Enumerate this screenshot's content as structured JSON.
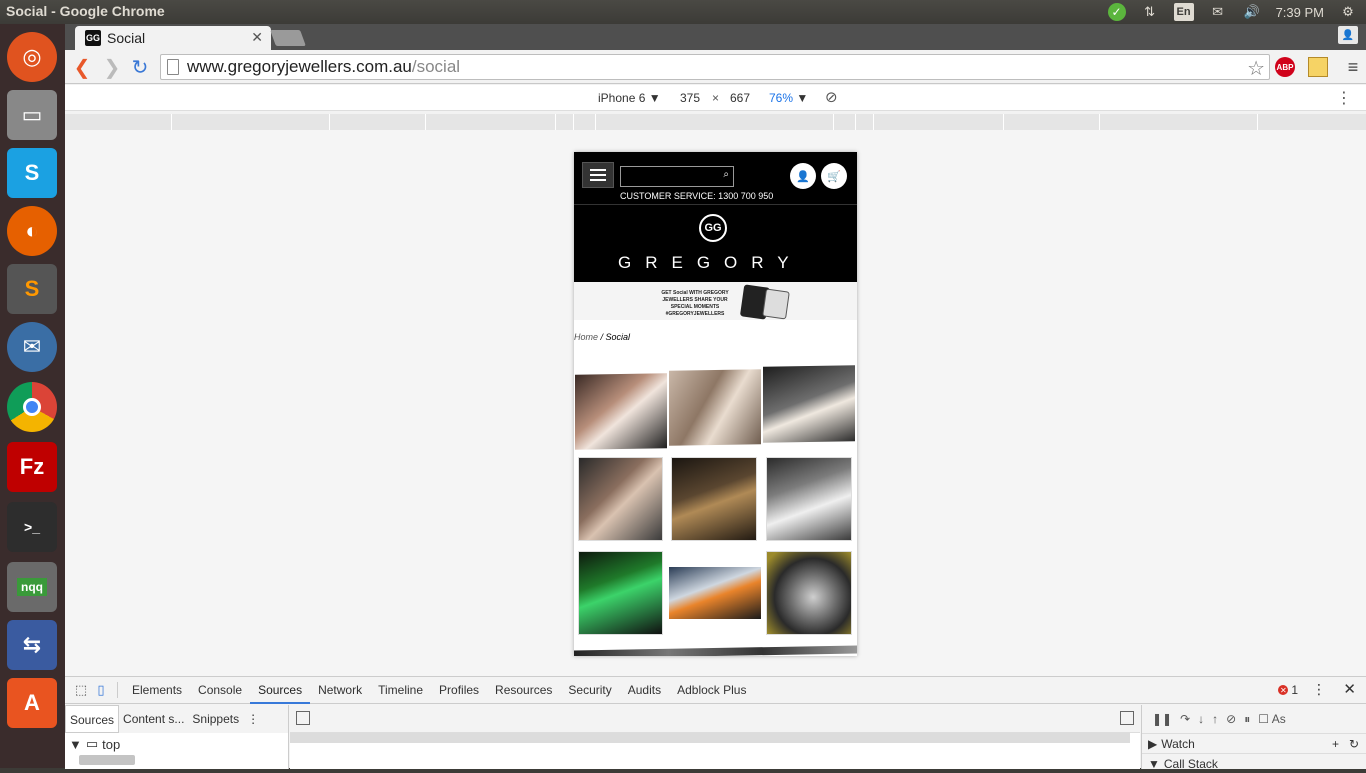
{
  "os": {
    "window_title": "Social - Google Chrome",
    "clock": "7:39 PM",
    "lang": "En"
  },
  "launcher": {
    "apps": [
      "ubuntu-icon",
      "files-icon",
      "skype-icon",
      "firefox-icon",
      "sublime-icon",
      "thunderbird-icon",
      "chrome-icon",
      "filezilla-icon",
      "terminal-icon",
      "nqq-icon",
      "network-icon",
      "software-center-icon"
    ],
    "nqq_label": "nqq"
  },
  "browser": {
    "tab_title": "Social",
    "url_host": "www.gregoryjewellers.com.au",
    "url_path": "/social",
    "abp_label": "ABP"
  },
  "device": {
    "name": "iPhone 6",
    "width": "375",
    "times": "×",
    "height": "667",
    "zoom": "76%"
  },
  "site": {
    "customer_service": "CUSTOMER SERVICE: 1300 700 950",
    "logo_text": "GREGORY",
    "logo_mark": "GG",
    "banner_text": "GET Social WITH GREGORY JEWELLERS SHARE YOUR SPECIAL MOMENTS #GREGORYJEWELLERS",
    "breadcrumb_home": "Home",
    "breadcrumb_sep": " / ",
    "breadcrumb_current": "Social"
  },
  "devtools": {
    "tabs": [
      "Elements",
      "Console",
      "Sources",
      "Network",
      "Timeline",
      "Profiles",
      "Resources",
      "Security",
      "Audits",
      "Adblock Plus"
    ],
    "active_tab": "Sources",
    "error_count": "1",
    "sub_tabs": [
      "Sources",
      "Content s...",
      "Snippets"
    ],
    "tree_item": "top",
    "right_pane": {
      "watch": "Watch",
      "call_stack": "Call Stack",
      "async_label": "As"
    }
  }
}
